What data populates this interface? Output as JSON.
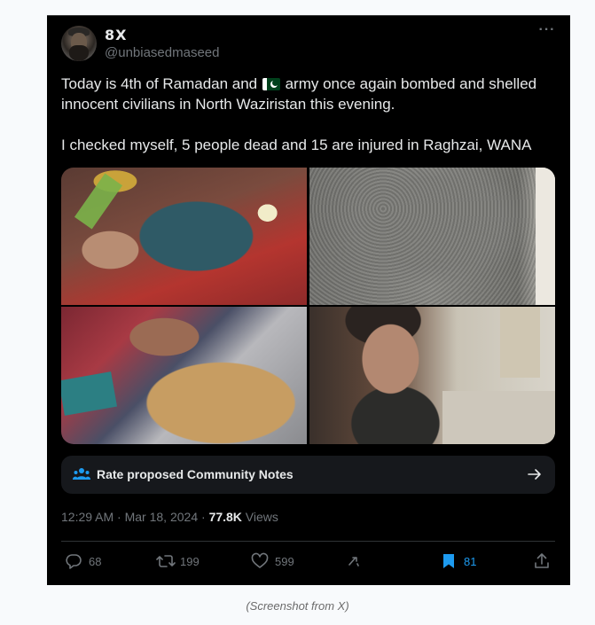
{
  "tweet": {
    "display_name": "8X",
    "handle": "@unbiasedmaseed",
    "text_before_flag": "Today is 4th of Ramadan and ",
    "flag_icon": "pakistan-flag-icon",
    "text_after_flag": " army once again bombed and shelled innocent civilians in North Waziristan this evening.",
    "text_second_paragraph": "I checked myself, 5 people dead and 15 are injured in Raghzai, WANA",
    "media_count": 4
  },
  "community_notes": {
    "label": "Rate proposed Community Notes",
    "icon": "people-icon"
  },
  "meta": {
    "time": "12:29 AM",
    "separator": " · ",
    "date": "Mar 18, 2024",
    "separator2": " · ",
    "views_count": "77.8K",
    "views_label": " Views"
  },
  "actions": {
    "replies": "68",
    "retweets": "199",
    "likes": "599",
    "bookmarks": "81"
  },
  "caption": "(Screenshot from X)",
  "colors": {
    "background": "#000000",
    "text": "#e7e9ea",
    "muted": "#71767b",
    "accent": "#1d9bf0",
    "page": "#f8fafc"
  }
}
